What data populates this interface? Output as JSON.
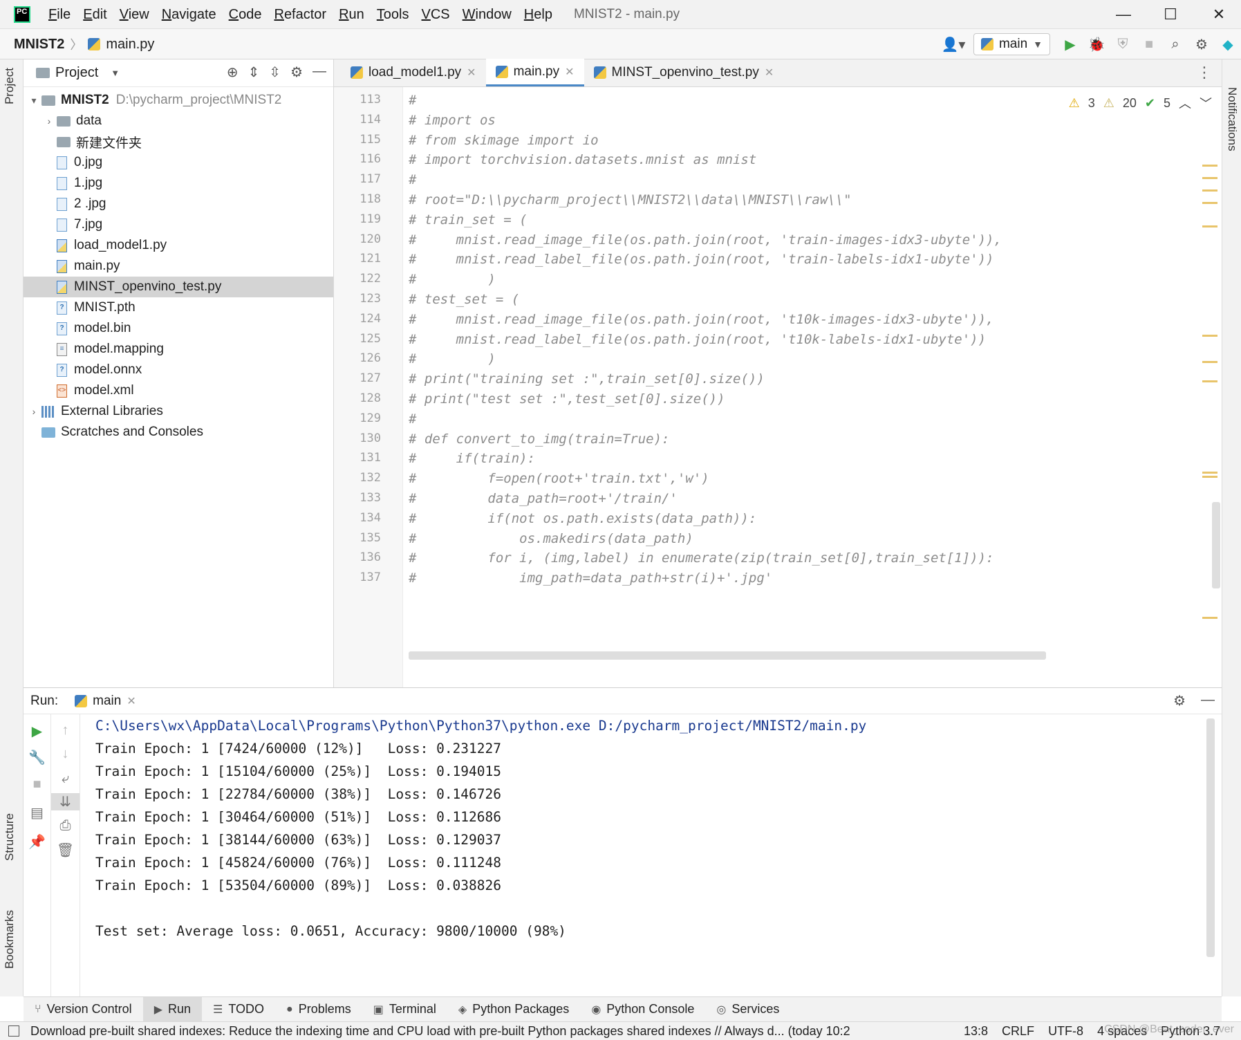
{
  "window": {
    "logo_text": "PC",
    "title": "MNIST2 - main.py",
    "menu": [
      "File",
      "Edit",
      "View",
      "Navigate",
      "Code",
      "Refactor",
      "Run",
      "Tools",
      "VCS",
      "Window",
      "Help"
    ],
    "controls": {
      "minimize": "—",
      "maximize": "☐",
      "close": "✕"
    }
  },
  "navbar": {
    "project": "MNIST2",
    "file": "main.py",
    "run_config": "main"
  },
  "left_strip": {
    "project_tab": "Project",
    "structure_tab": "Structure",
    "bookmarks_tab": "Bookmarks"
  },
  "right_strip": {
    "notifications_tab": "Notifications"
  },
  "project_panel": {
    "title": "Project",
    "root": {
      "name": "MNIST2",
      "path": "D:\\pycharm_project\\MNIST2"
    },
    "items": [
      {
        "name": "data",
        "kind": "folder",
        "expandable": true
      },
      {
        "name": "新建文件夹",
        "kind": "folder",
        "expandable": false
      },
      {
        "name": "0.jpg",
        "kind": "image"
      },
      {
        "name": "1.jpg",
        "kind": "image"
      },
      {
        "name": "2 .jpg",
        "kind": "image"
      },
      {
        "name": "7.jpg",
        "kind": "image"
      },
      {
        "name": "load_model1.py",
        "kind": "python"
      },
      {
        "name": "main.py",
        "kind": "python"
      },
      {
        "name": "MINST_openvino_test.py",
        "kind": "python",
        "selected": true
      },
      {
        "name": "MNIST.pth",
        "kind": "unknown"
      },
      {
        "name": "model.bin",
        "kind": "unknown"
      },
      {
        "name": "model.mapping",
        "kind": "text"
      },
      {
        "name": "model.onnx",
        "kind": "unknown"
      },
      {
        "name": "model.xml",
        "kind": "xml"
      }
    ],
    "external_libraries": "External Libraries",
    "scratches": "Scratches and Consoles"
  },
  "editor": {
    "tabs": [
      {
        "label": "load_model1.py",
        "active": false
      },
      {
        "label": "main.py",
        "active": true
      },
      {
        "label": "MINST_openvino_test.py",
        "active": false
      }
    ],
    "inspections": {
      "warnings": "3",
      "weak_warnings": "20",
      "ok": "5"
    },
    "lines": [
      {
        "n": "113",
        "text": "#"
      },
      {
        "n": "114",
        "text": "# import os"
      },
      {
        "n": "115",
        "text": "# from skimage import io"
      },
      {
        "n": "116",
        "text": "# import torchvision.datasets.mnist as mnist"
      },
      {
        "n": "117",
        "text": "#"
      },
      {
        "n": "118",
        "text": "# root=\"D:\\\\pycharm_project\\\\MNIST2\\\\data\\\\MNIST\\\\raw\\\\\""
      },
      {
        "n": "119",
        "text": "# train_set = ("
      },
      {
        "n": "120",
        "text": "#     mnist.read_image_file(os.path.join(root, 'train-images-idx3-ubyte')),"
      },
      {
        "n": "121",
        "text": "#     mnist.read_label_file(os.path.join(root, 'train-labels-idx1-ubyte'))"
      },
      {
        "n": "122",
        "text": "#         )"
      },
      {
        "n": "123",
        "text": "# test_set = ("
      },
      {
        "n": "124",
        "text": "#     mnist.read_image_file(os.path.join(root, 't10k-images-idx3-ubyte')),"
      },
      {
        "n": "125",
        "text": "#     mnist.read_label_file(os.path.join(root, 't10k-labels-idx1-ubyte'))"
      },
      {
        "n": "126",
        "text": "#         )"
      },
      {
        "n": "127",
        "text": "# print(\"training set :\",train_set[0].size())"
      },
      {
        "n": "128",
        "text": "# print(\"test set :\",test_set[0].size())"
      },
      {
        "n": "129",
        "text": "#"
      },
      {
        "n": "130",
        "text": "# def convert_to_img(train=True):"
      },
      {
        "n": "131",
        "text": "#     if(train):"
      },
      {
        "n": "132",
        "text": "#         f=open(root+'train.txt','w')"
      },
      {
        "n": "133",
        "text": "#         data_path=root+'/train/'"
      },
      {
        "n": "134",
        "text": "#         if(not os.path.exists(data_path)):"
      },
      {
        "n": "135",
        "text": "#             os.makedirs(data_path)"
      },
      {
        "n": "136",
        "text": "#         for i, (img,label) in enumerate(zip(train_set[0],train_set[1])):"
      },
      {
        "n": "137",
        "text": "#             img_path=data_path+str(i)+'.jpg'"
      }
    ]
  },
  "run_panel": {
    "label": "Run:",
    "tab": "main",
    "output": [
      "C:\\Users\\wx\\AppData\\Local\\Programs\\Python\\Python37\\python.exe D:/pycharm_project/MNIST2/main.py",
      "Train Epoch: 1 [7424/60000 (12%)]   Loss: 0.231227",
      "Train Epoch: 1 [15104/60000 (25%)]  Loss: 0.194015",
      "Train Epoch: 1 [22784/60000 (38%)]  Loss: 0.146726",
      "Train Epoch: 1 [30464/60000 (51%)]  Loss: 0.112686",
      "Train Epoch: 1 [38144/60000 (63%)]  Loss: 0.129037",
      "Train Epoch: 1 [45824/60000 (76%)]  Loss: 0.111248",
      "Train Epoch: 1 [53504/60000 (89%)]  Loss: 0.038826",
      "",
      "Test set: Average loss: 0.0651, Accuracy: 9800/10000 (98%)"
    ]
  },
  "bottom_tabs": [
    {
      "label": "Version Control",
      "icon": "⑂"
    },
    {
      "label": "Run",
      "icon": "▶",
      "active": true
    },
    {
      "label": "TODO",
      "icon": "☰"
    },
    {
      "label": "Problems",
      "icon": "●"
    },
    {
      "label": "Terminal",
      "icon": "▣"
    },
    {
      "label": "Python Packages",
      "icon": "◈"
    },
    {
      "label": "Python Console",
      "icon": "◉"
    },
    {
      "label": "Services",
      "icon": "◎"
    }
  ],
  "statusbar": {
    "message": "Download pre-built shared indexes: Reduce the indexing time and CPU load with pre-built Python packages shared indexes // Always d... (today 10:2",
    "position": "13:8",
    "line_sep": "CRLF",
    "encoding": "UTF-8",
    "indent": "4 spaces",
    "interpreter": "Python 3.7",
    "watermark": "CSDN @Beat_coder_ever"
  }
}
